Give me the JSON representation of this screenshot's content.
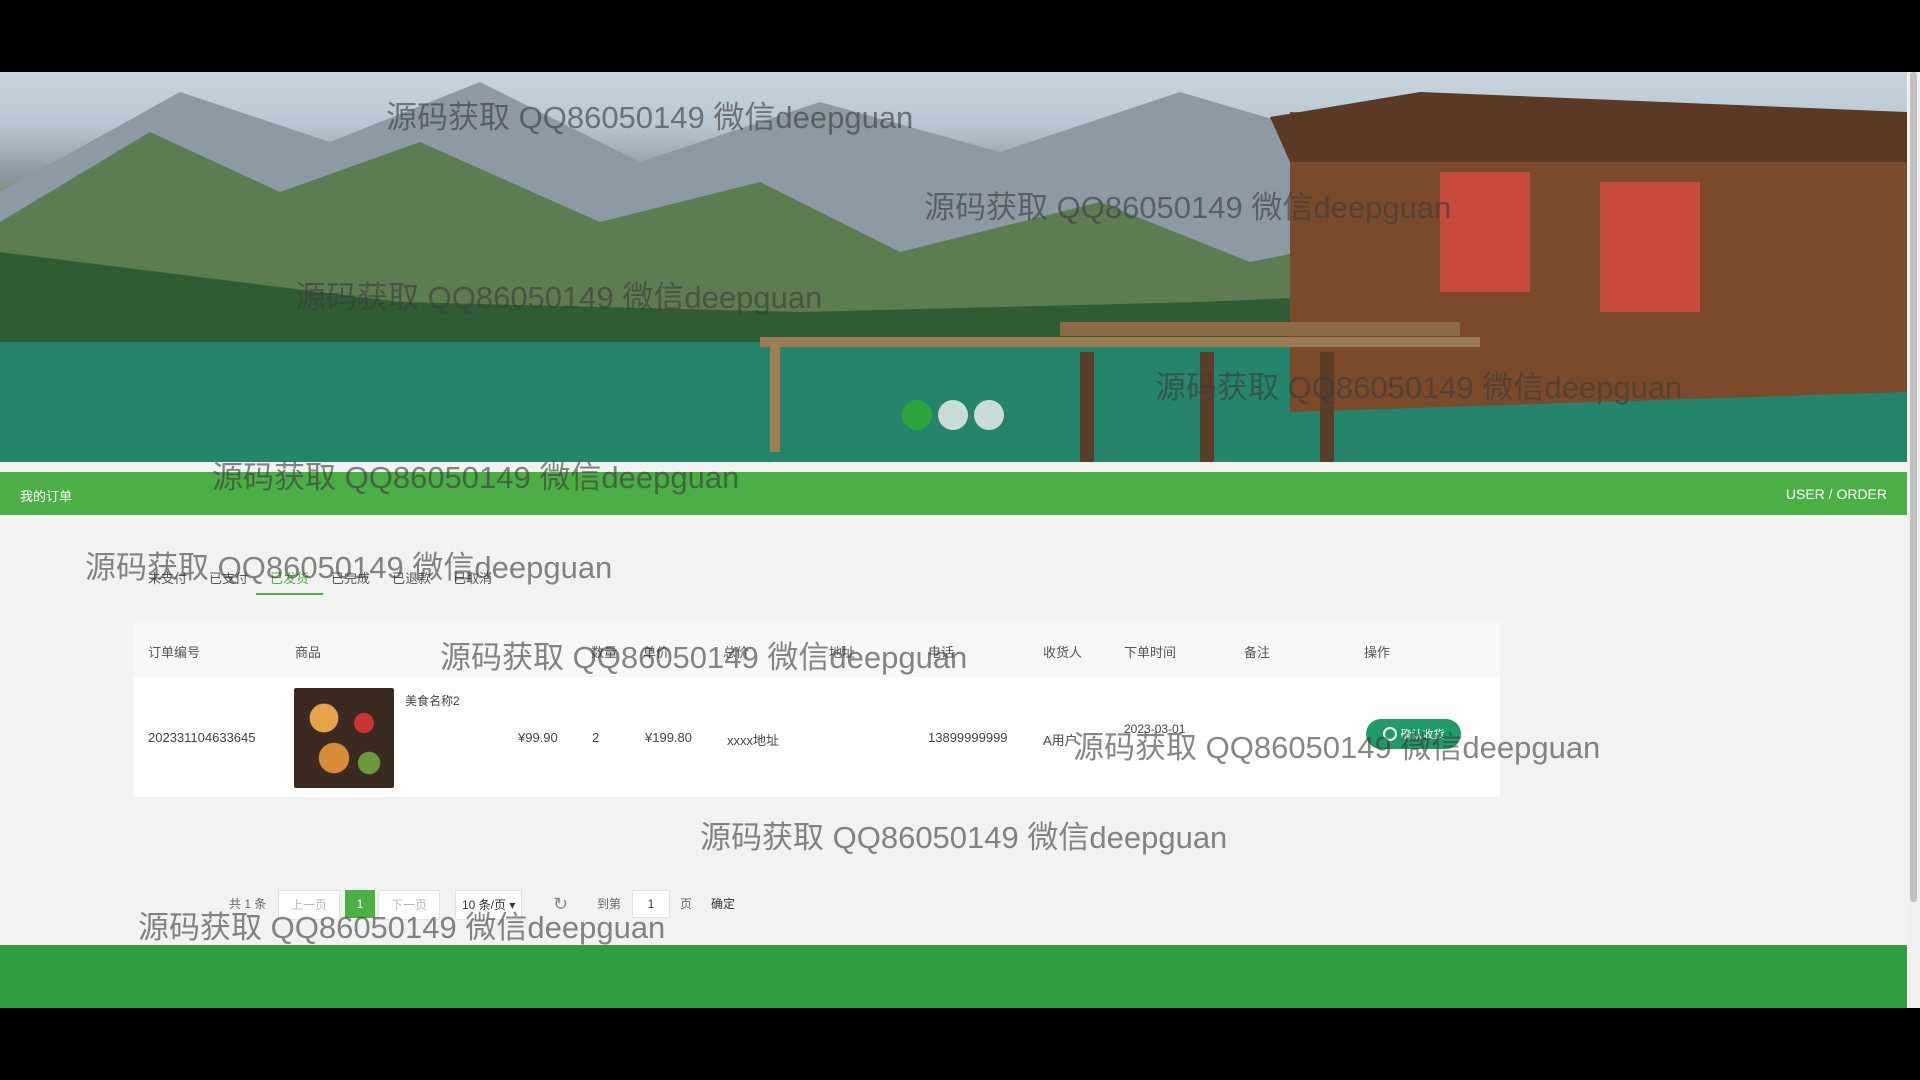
{
  "section": {
    "title": "我的订单",
    "crumb": "USER / ORDER"
  },
  "tabs": [
    "未支付",
    "已支付",
    "已发货",
    "已完成",
    "已退款",
    "已取消"
  ],
  "active_tab": "已发货",
  "table": {
    "headers": [
      "订单编号",
      "商品",
      "数量",
      "单价",
      "总价",
      "地址",
      "电话",
      "收货人",
      "下单时间",
      "备注",
      "操作"
    ],
    "rows": [
      {
        "order_no": "202331104633645",
        "product": "美食名称2",
        "unit_price": "¥99.90",
        "qty": "2",
        "total": "¥199.80",
        "address": "xxxx地址",
        "phone": "13899999999",
        "receiver": "A用户",
        "time": "2023-03-01",
        "note": "",
        "action": "确认收货"
      }
    ]
  },
  "pager": {
    "total": "共 1 条",
    "prev": "上一页",
    "page": "1",
    "next": "下一页",
    "size": "10 条/页",
    "goto": "到第",
    "goto_value": "1",
    "page_unit": "页",
    "confirm": "确定"
  },
  "watermark": "源码获取 QQ86050149 微信deepguan",
  "colors": {
    "primary": "#4caf45",
    "footer": "#2f9e3e",
    "action": "#1f9b6a"
  },
  "carousel": {
    "slides": 3,
    "active": 1
  }
}
